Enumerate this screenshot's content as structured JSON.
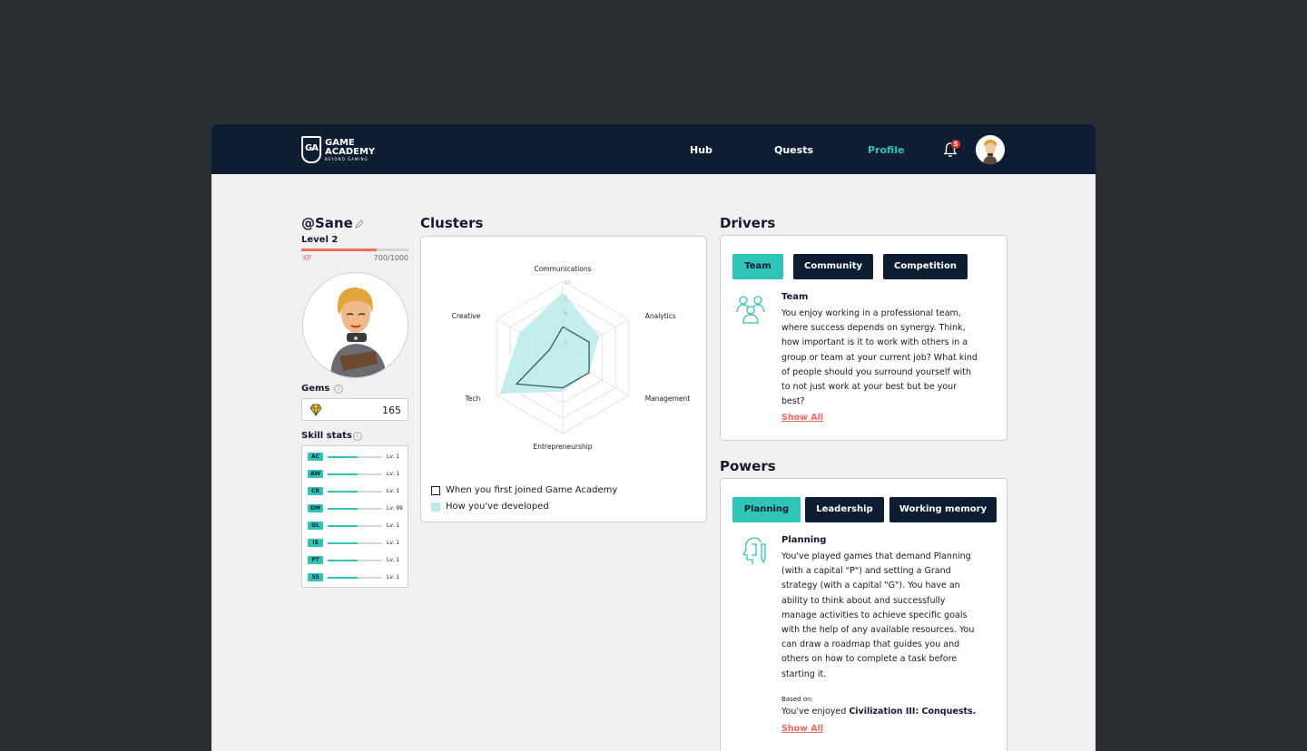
{
  "nav": {
    "logo_line1": "GAME",
    "logo_line2": "ACADEMY",
    "logo_tagline": "BEYOND GAMING",
    "logo_mark": "GA",
    "items": [
      {
        "label": "Hub"
      },
      {
        "label": "Quests"
      },
      {
        "label": "Profile"
      }
    ],
    "active": "Profile",
    "notification_count": "5",
    "bell_icon": "bell-icon"
  },
  "profile": {
    "handle": "@Sane",
    "level": "Level 2",
    "xp_label": "XP",
    "xp_value": "700/1000",
    "xp_fraction": 0.7,
    "gems_title": "Gems",
    "gems_value": "165",
    "skills_title": "Skill stats",
    "skills": [
      {
        "code": "AC",
        "level": "Lv. 1",
        "fraction": 0.55
      },
      {
        "code": "AW",
        "level": "Lv. 1",
        "fraction": 0.55
      },
      {
        "code": "CR",
        "level": "Lv. 1",
        "fraction": 0.55
      },
      {
        "code": "DM",
        "level": "Lv. 99",
        "fraction": 0.55
      },
      {
        "code": "GL",
        "level": "Lv. 1",
        "fraction": 0.55
      },
      {
        "code": "IS",
        "level": "Lv. 1",
        "fraction": 0.55
      },
      {
        "code": "PT",
        "level": "Lv. 1",
        "fraction": 0.55
      },
      {
        "code": "SS",
        "level": "Lv. 1",
        "fraction": 0.55
      }
    ]
  },
  "clusters": {
    "title": "Clusters",
    "legend_first": "When you first joined Game Academy",
    "legend_developed": "How you've developed",
    "chart_data": {
      "type": "radar",
      "axes": [
        "Communications",
        "Analytics",
        "Management",
        "Entrepreneurship",
        "Tech",
        "Creative"
      ],
      "ticks": [
        "2",
        "4",
        "6",
        "8",
        "10"
      ],
      "range": [
        0,
        10
      ],
      "series": [
        {
          "name": "When you first joined Game Academy",
          "values": [
            4,
            4,
            4,
            4,
            7,
            2
          ]
        },
        {
          "name": "How you've developed",
          "values": [
            8.5,
            5.5,
            4,
            4.5,
            9.5,
            6.5
          ]
        }
      ],
      "colors": {
        "developed": "#b8ebea",
        "first": "#3b5a58"
      }
    }
  },
  "drivers": {
    "title": "Drivers",
    "tabs": [
      {
        "label": "Team"
      },
      {
        "label": "Community"
      },
      {
        "label": "Competition"
      }
    ],
    "active_tab": "Team",
    "desc_title": "Team",
    "desc_lines": [
      "You enjoy working in a professional team,",
      "where success depends on synergy. Think,",
      "how important is it to work with others in a",
      "group or team at your current job? What kind",
      "of people should you surround yourself with",
      "to not just work at your best but be your",
      "best?"
    ],
    "show_all": "Show All",
    "icon": "team-icon"
  },
  "powers": {
    "title": "Powers",
    "tabs": [
      {
        "label": "Planning"
      },
      {
        "label": "Leadership"
      },
      {
        "label": "Working memory"
      }
    ],
    "active_tab": "Planning",
    "desc_title": "Planning",
    "desc_lines": [
      "You've played games that demand Planning",
      "(with a capital \"P\") and setting a Grand",
      "strategy (with a capital \"G\"). You have an",
      "ability to think about and successfully",
      "manage activities to achieve specific goals",
      "with the help of any available resources. You",
      "can draw a roadmap that guides you and",
      "others on how to complete a task before",
      "starting it."
    ],
    "based_on_label": "Based on:",
    "enjoyed_prefix": "You've enjoyed ",
    "enjoyed_game": "Civilization III: Conquests.",
    "show_all": "Show All",
    "icon": "planning-head-icon"
  },
  "colors": {
    "navy": "#0f1d33",
    "teal": "#2ec4b6",
    "coral": "#f26b5b",
    "page_bg": "#2b2f33",
    "panel_bg": "#f1f1f1"
  }
}
